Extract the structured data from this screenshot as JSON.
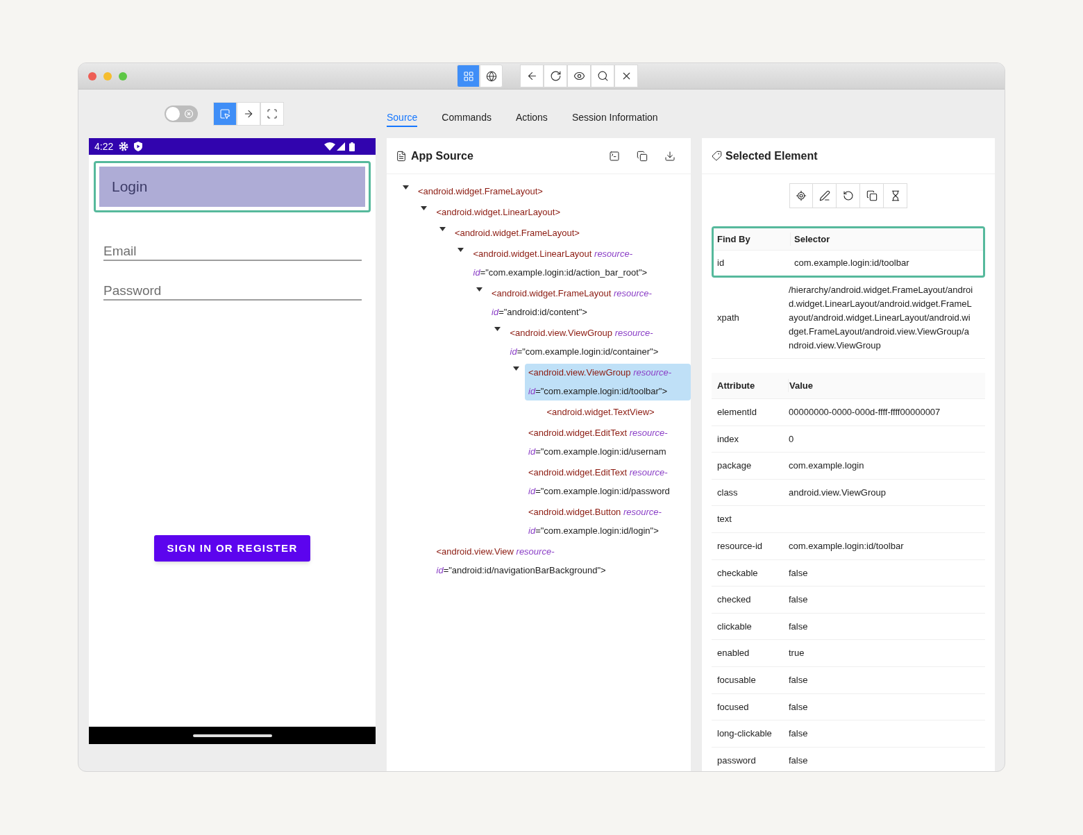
{
  "title_bar": {
    "mode_buttons": [
      {
        "selected": true
      },
      {
        "selected": false
      }
    ]
  },
  "inspector_toggle": {
    "on": false
  },
  "gesture_modes": [
    {
      "selected": true
    },
    {
      "selected": false
    },
    {
      "selected": false
    }
  ],
  "tabs": [
    {
      "label": "Source",
      "selected": true
    },
    {
      "label": "Commands",
      "selected": false
    },
    {
      "label": "Actions",
      "selected": false
    },
    {
      "label": "Session Information",
      "selected": false
    }
  ],
  "device": {
    "time": "4:22",
    "toolbar_title": "Login",
    "fields": [
      {
        "placeholder": "Email"
      },
      {
        "placeholder": "Password"
      }
    ],
    "button": "SIGN IN OR REGISTER"
  },
  "app_source": {
    "title": "App Source",
    "tree": [
      {
        "tag": "<android.widget.FrameLayout>",
        "expanded": true,
        "selected": false,
        "children": [
          {
            "tag": "<android.widget.LinearLayout>",
            "expanded": true,
            "selected": false,
            "children": [
              {
                "tag": "<android.widget.FrameLayout>",
                "expanded": true,
                "selected": false,
                "children": [
                  {
                    "tag": "<android.widget.LinearLayout",
                    "attr": "resource-id",
                    "value": "=\"com.example.login:id/action_bar_root\">",
                    "expanded": true,
                    "selected": false,
                    "children": [
                      {
                        "tag": "<android.widget.FrameLayout",
                        "attr": "resource-id",
                        "value": "=\"android:id/content\">",
                        "expanded": true,
                        "selected": false,
                        "children": [
                          {
                            "tag": "<android.view.ViewGroup",
                            "attr": "resource-id",
                            "value": "=\"com.example.login:id/container\">",
                            "expanded": true,
                            "selected": false,
                            "children": [
                              {
                                "tag": "<android.view.ViewGroup",
                                "attr": "resource-id",
                                "value": "=\"com.example.login:id/toolbar\">",
                                "expanded": true,
                                "selected": true,
                                "children": [
                                  {
                                    "tag": "<android.widget.TextView>",
                                    "selected": false
                                  }
                                ]
                              },
                              {
                                "tag": "<android.widget.EditText",
                                "attr": "resource-id",
                                "value": "=\"com.example.login:id/usernam",
                                "selected": false
                              },
                              {
                                "tag": "<android.widget.EditText",
                                "attr": "resource-id",
                                "value": "=\"com.example.login:id/password",
                                "selected": false
                              },
                              {
                                "tag": "<android.widget.Button",
                                "attr": "resource-id",
                                "value": "=\"com.example.login:id/login\">",
                                "selected": false
                              }
                            ]
                          }
                        ]
                      }
                    ]
                  }
                ]
              }
            ]
          },
          {
            "tag": "<android.view.View",
            "attr": "resource-id",
            "value": "=\"android:id/navigationBarBackground\">",
            "selected": false
          }
        ]
      }
    ]
  },
  "selected_element": {
    "title": "Selected Element",
    "selector_columns": [
      "Find By",
      "Selector"
    ],
    "selectors": [
      {
        "find_by": "id",
        "selector": "com.example.login:id/toolbar"
      },
      {
        "find_by": "xpath",
        "selector": "/hierarchy/android.widget.FrameLayout/android.widget.LinearLayout/android.widget.FrameLayout/android.widget.LinearLayout/android.widget.FrameLayout/android.view.ViewGroup/android.view.ViewGroup"
      }
    ],
    "attribute_columns": [
      "Attribute",
      "Value"
    ],
    "attributes": [
      {
        "name": "elementId",
        "value": "00000000-0000-000d-ffff-ffff00000007"
      },
      {
        "name": "index",
        "value": "0"
      },
      {
        "name": "package",
        "value": "com.example.login"
      },
      {
        "name": "class",
        "value": "android.view.ViewGroup"
      },
      {
        "name": "text"
      },
      {
        "name": "resource-id",
        "value": "com.example.login:id/toolbar"
      },
      {
        "name": "checkable",
        "value": "false"
      },
      {
        "name": "checked",
        "value": "false"
      },
      {
        "name": "clickable",
        "value": "false"
      },
      {
        "name": "enabled",
        "value": "true"
      },
      {
        "name": "focusable",
        "value": "false"
      },
      {
        "name": "focused",
        "value": "false"
      },
      {
        "name": "long-clickable",
        "value": "false"
      },
      {
        "name": "password",
        "value": "false"
      }
    ]
  }
}
